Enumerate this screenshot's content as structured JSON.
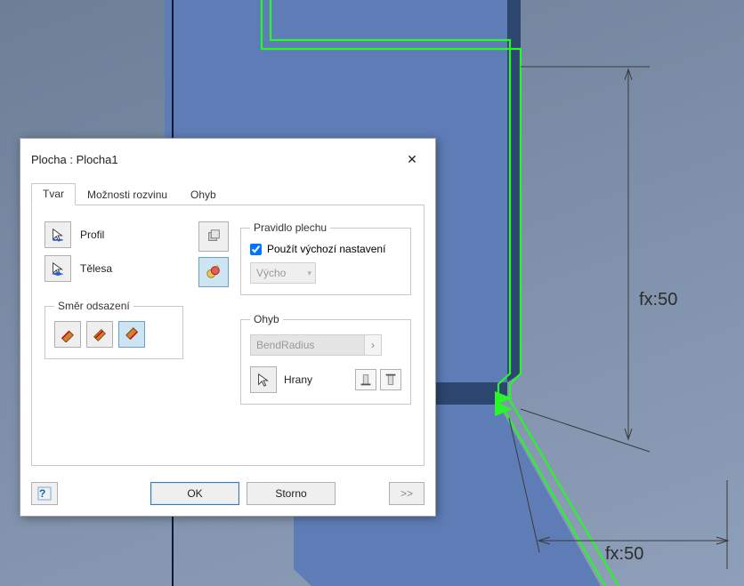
{
  "dialog": {
    "title": "Plocha : Plocha1",
    "tabs": {
      "shape": "Tvar",
      "unfold": "Možnosti rozvinu",
      "bend": "Ohyb"
    },
    "shapeTab": {
      "profile_label": "Profil",
      "bodies_label": "Tělesa",
      "offset_legend": "Směr odsazení",
      "sheet_rule_legend": "Pravidlo plechu",
      "use_default_label": "Použít výchozí nastavení",
      "default_select": "Výcho",
      "bend_legend": "Ohyb",
      "bend_radius": "BendRadius",
      "edges_label": "Hrany"
    },
    "buttons": {
      "ok": "OK",
      "cancel": "Storno",
      "more": ">>"
    }
  },
  "scene": {
    "dimensions": {
      "right": "fx:50",
      "bottom": "fx:50"
    }
  },
  "colors": {
    "selection_green": "#29f52a",
    "face_blue": "#5e7db6",
    "face_blue_dark": "#516ea3",
    "dim_line": "#3a3a3a"
  }
}
